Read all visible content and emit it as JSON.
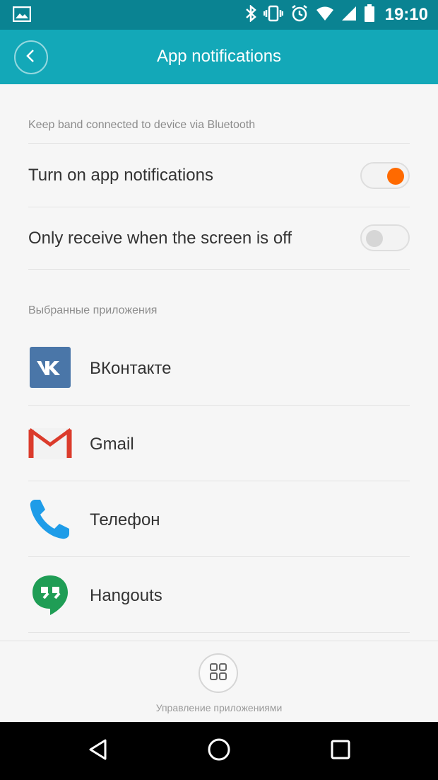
{
  "status_bar": {
    "time": "19:10",
    "icons": [
      "image-icon",
      "bluetooth-icon",
      "vibrate-icon",
      "alarm-icon",
      "wifi-icon",
      "cell-signal-icon",
      "battery-icon"
    ]
  },
  "app_bar": {
    "title": "App notifications",
    "back_icon": "chevron-left-icon"
  },
  "settings": {
    "section_header": "Keep band connected to device via Bluetooth",
    "items": [
      {
        "label": "Turn on app notifications",
        "enabled": true
      },
      {
        "label": "Only receive when the screen is off",
        "enabled": false
      }
    ]
  },
  "apps": {
    "section_header": "Выбранные приложения",
    "items": [
      {
        "label": "ВКонтакте",
        "icon": "vk-icon"
      },
      {
        "label": "Gmail",
        "icon": "gmail-icon"
      },
      {
        "label": "Телефон",
        "icon": "phone-icon"
      },
      {
        "label": "Hangouts",
        "icon": "hangouts-icon"
      }
    ]
  },
  "bottom": {
    "manage_label": "Управление приложениями",
    "manage_icon": "grid-icon"
  },
  "nav_bar": {
    "icons": [
      "back-triangle-icon",
      "home-circle-icon",
      "recents-square-icon"
    ]
  },
  "colors": {
    "status_bar": "#0a8392",
    "app_bar": "#13a8b8",
    "toggle_on": "#ff6a00",
    "toggle_off_knob": "#d6d6d6",
    "background": "#f6f6f6"
  }
}
